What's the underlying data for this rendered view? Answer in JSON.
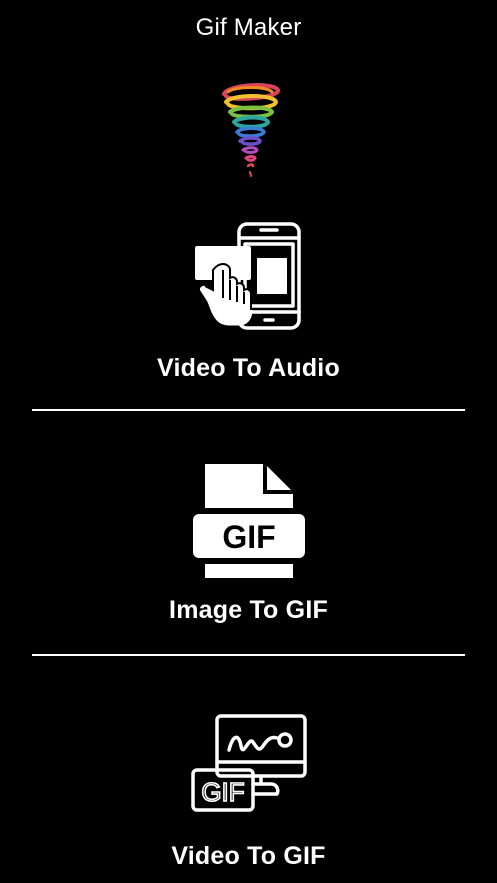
{
  "app": {
    "title": "Gif Maker",
    "background_color": "#000000",
    "text_color": "#ffffff"
  },
  "logo": {
    "icon": "rainbow-tornado-logo"
  },
  "menu": {
    "items": [
      {
        "id": "video-to-audio",
        "label": "Video To Audio",
        "icon": "phone-tap-icon"
      },
      {
        "id": "image-to-gif",
        "label": "Image To GIF",
        "icon": "gif-file-icon",
        "icon_text": "GIF"
      },
      {
        "id": "video-to-gif",
        "label": "Video To GIF",
        "icon": "video-gif-icon",
        "icon_text": "GIF"
      }
    ]
  }
}
